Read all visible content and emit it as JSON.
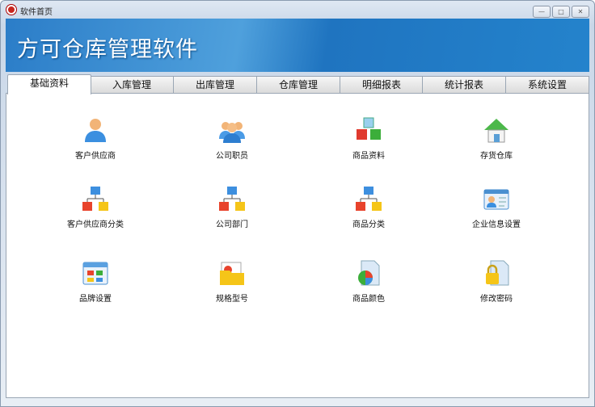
{
  "window": {
    "title": "软件首页",
    "min": "—",
    "max": "□",
    "close": "✕"
  },
  "banner": {
    "title": "方可仓库管理软件"
  },
  "tabs": [
    {
      "label": "基础资料",
      "active": true
    },
    {
      "label": "入库管理"
    },
    {
      "label": "出库管理"
    },
    {
      "label": "仓库管理"
    },
    {
      "label": "明细报表"
    },
    {
      "label": "统计报表"
    },
    {
      "label": "系统设置"
    }
  ],
  "items": [
    {
      "label": "客户供应商",
      "icon": "user-icon"
    },
    {
      "label": "公司职员",
      "icon": "users-icon"
    },
    {
      "label": "商品资料",
      "icon": "cubes-icon"
    },
    {
      "label": "存货仓库",
      "icon": "house-icon"
    },
    {
      "label": "客户供应商分类",
      "icon": "hierarchy-icon"
    },
    {
      "label": "公司部门",
      "icon": "hierarchy-icon"
    },
    {
      "label": "商品分类",
      "icon": "hierarchy-icon"
    },
    {
      "label": "企业信息设置",
      "icon": "id-card-icon"
    },
    {
      "label": "品牌设置",
      "icon": "window-grid-icon"
    },
    {
      "label": "规格型号",
      "icon": "folder-icon"
    },
    {
      "label": "商品颜色",
      "icon": "pie-document-icon"
    },
    {
      "label": "修改密码",
      "icon": "lock-document-icon"
    }
  ]
}
